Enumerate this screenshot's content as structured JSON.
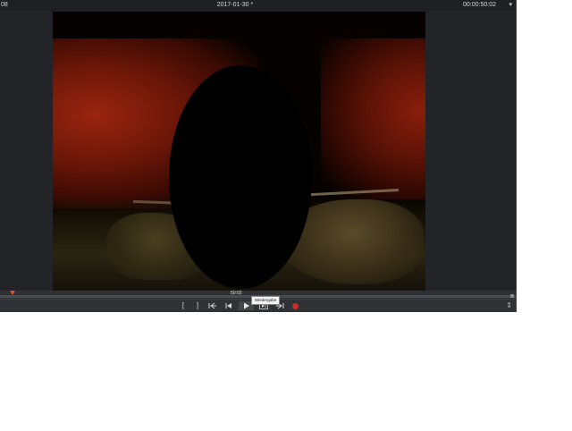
{
  "titlebar": {
    "left_text": "08",
    "title": "2017-01-30 *",
    "timecode": "00:00:50:02",
    "menu_glyph": "▾"
  },
  "timeline": {
    "current_time": "50:02"
  },
  "controls": {
    "mark_in": "[",
    "mark_out": "]",
    "prev_edit_icon": "go-to-start-icon",
    "prev_frame_icon": "step-back-icon",
    "play_icon": "play-icon",
    "next_frame_icon": "step-forward-icon",
    "next_edit_icon": "go-to-end-icon",
    "record_icon": "record-icon",
    "tail_glyph": "⇕",
    "record_color": "#c83024"
  },
  "tooltip": {
    "text": "Wiedergabe"
  }
}
